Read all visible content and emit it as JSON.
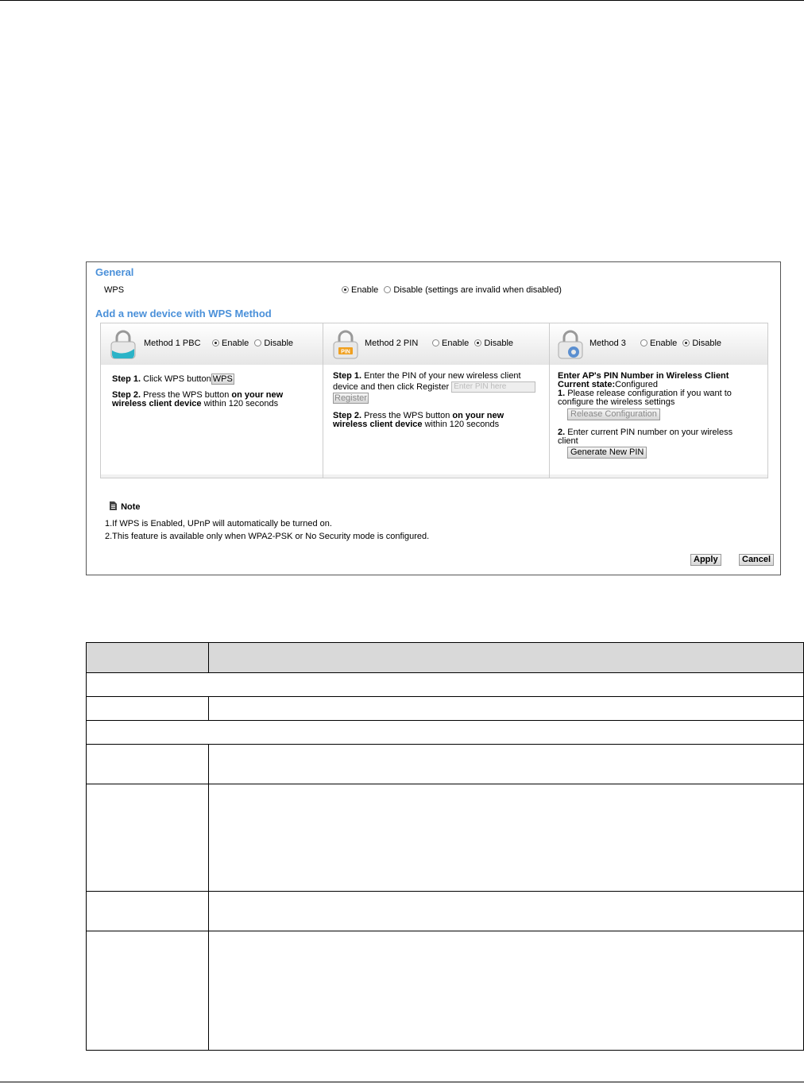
{
  "general": {
    "title": "General",
    "wps_label": "WPS",
    "enable_label": "Enable",
    "disable_label": "Disable (settings are invalid when disabled)"
  },
  "add_device": {
    "title": "Add a new device with WPS Method"
  },
  "method1": {
    "name": "Method 1 PBC",
    "enable_label": "Enable",
    "disable_label": "Disable",
    "step1_bold": "Step 1.",
    "step1_text": " Click WPS button",
    "wps_button": "WPS",
    "step2_bold": "Step 2.",
    "step2_text1": " Press the WPS button ",
    "step2_bold2": "on your new",
    "step2_bold3": "wireless client device",
    "step2_text2": " within 120 seconds"
  },
  "method2": {
    "name": "Method 2 PIN",
    "enable_label": "Enable",
    "disable_label": "Disable",
    "step1_bold": "Step 1.",
    "step1_text1": " Enter the PIN of your new wireless client",
    "step1_text2": "device and then click Register ",
    "pin_placeholder": "Enter PIN here",
    "register_button": "Register",
    "step2_bold": "Step 2.",
    "step2_text1": " Press the WPS button ",
    "step2_bold2": "on your new",
    "step2_bold3": "wireless client device",
    "step2_text2": " within 120 seconds"
  },
  "method3": {
    "name": "Method 3",
    "enable_label": "Enable",
    "disable_label": "Disable",
    "title": "Enter AP's PIN Number in Wireless Client",
    "state_label": "Current state:",
    "state_value": "Configured",
    "item1_bold": "1.",
    "item1_text1": " Please release configuration if you want to",
    "item1_text2": "configure the wireless settings",
    "release_button": "Release Configuration",
    "item2_bold": "2.",
    "item2_text1": " Enter current PIN number  on your wireless",
    "item2_text2": "client",
    "generate_button": "Generate New PIN"
  },
  "note": {
    "title": "Note",
    "line1": "1.If WPS is Enabled, UPnP will automatically be turned on.",
    "line2": "2.This feature is available only when WPA2-PSK or No Security mode is configured."
  },
  "buttons": {
    "apply": "Apply",
    "cancel": "Cancel"
  },
  "colors": {
    "section_title": "#4a90d9",
    "lock_teal": "#2bb3c7",
    "lock_orange": "#f0a020",
    "table_header": "#d9d9d9"
  },
  "icons": [
    "lock-icon",
    "pin-lock-icon",
    "gear-lock-icon",
    "note-icon"
  ]
}
